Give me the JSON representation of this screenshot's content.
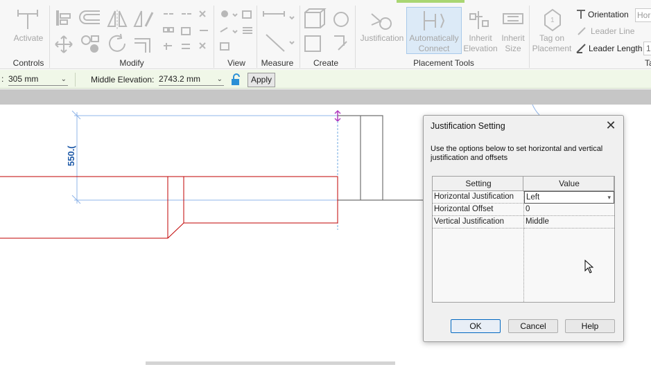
{
  "ribbon": {
    "controls": {
      "activate_label": "Activate",
      "panel_label": "Controls"
    },
    "modify": {
      "panel_label": "Modify"
    },
    "view": {
      "panel_label": "View"
    },
    "measure": {
      "panel_label": "Measure"
    },
    "create": {
      "panel_label": "Create"
    },
    "placement_tools": {
      "panel_label": "Placement Tools",
      "justification_label": "Justification",
      "auto_connect_line1": "Automatically",
      "auto_connect_line2": "Connect",
      "inherit_elevation_line1": "Inherit",
      "inherit_elevation_line2": "Elevation",
      "inherit_size_line1": "Inherit",
      "inherit_size_line2": "Size"
    },
    "tag": {
      "tag_on_placement_line1": "Tag on",
      "tag_on_placement_line2": "Placement",
      "orientation_label": "Orientation",
      "orientation_value": "Hor",
      "leader_line_label": "Leader Line",
      "leader_length_label": "Leader Length",
      "leader_length_value": "1",
      "panel_label_partial": "Ta"
    }
  },
  "options_bar": {
    "first_value_prefix": ":",
    "first_value": "305 mm",
    "middle_elevation_label": "Middle Elevation:",
    "middle_elevation_value": "2743.2 mm",
    "apply_label": "Apply"
  },
  "canvas": {
    "dimension_text": "550.("
  },
  "dialog": {
    "title": "Justification Setting",
    "close_glyph": "✕",
    "description": "Use the options below to set horizontal and vertical justification and offsets",
    "columns": [
      "Setting",
      "Value"
    ],
    "rows": [
      {
        "setting": "Horizontal Justification",
        "value": "Left"
      },
      {
        "setting": "Horizontal Offset",
        "value": "0"
      },
      {
        "setting": "Vertical Justification",
        "value": "Middle"
      }
    ],
    "ok_label": "OK",
    "cancel_label": "Cancel",
    "help_label": "Help"
  },
  "colors": {
    "options_bar_bg": "#f0f7e8",
    "accent_blue": "#1e5aa8",
    "duct_red": "#c00000",
    "guide_blue": "#8fb4e8",
    "grip_magenta": "#b03cc0"
  }
}
